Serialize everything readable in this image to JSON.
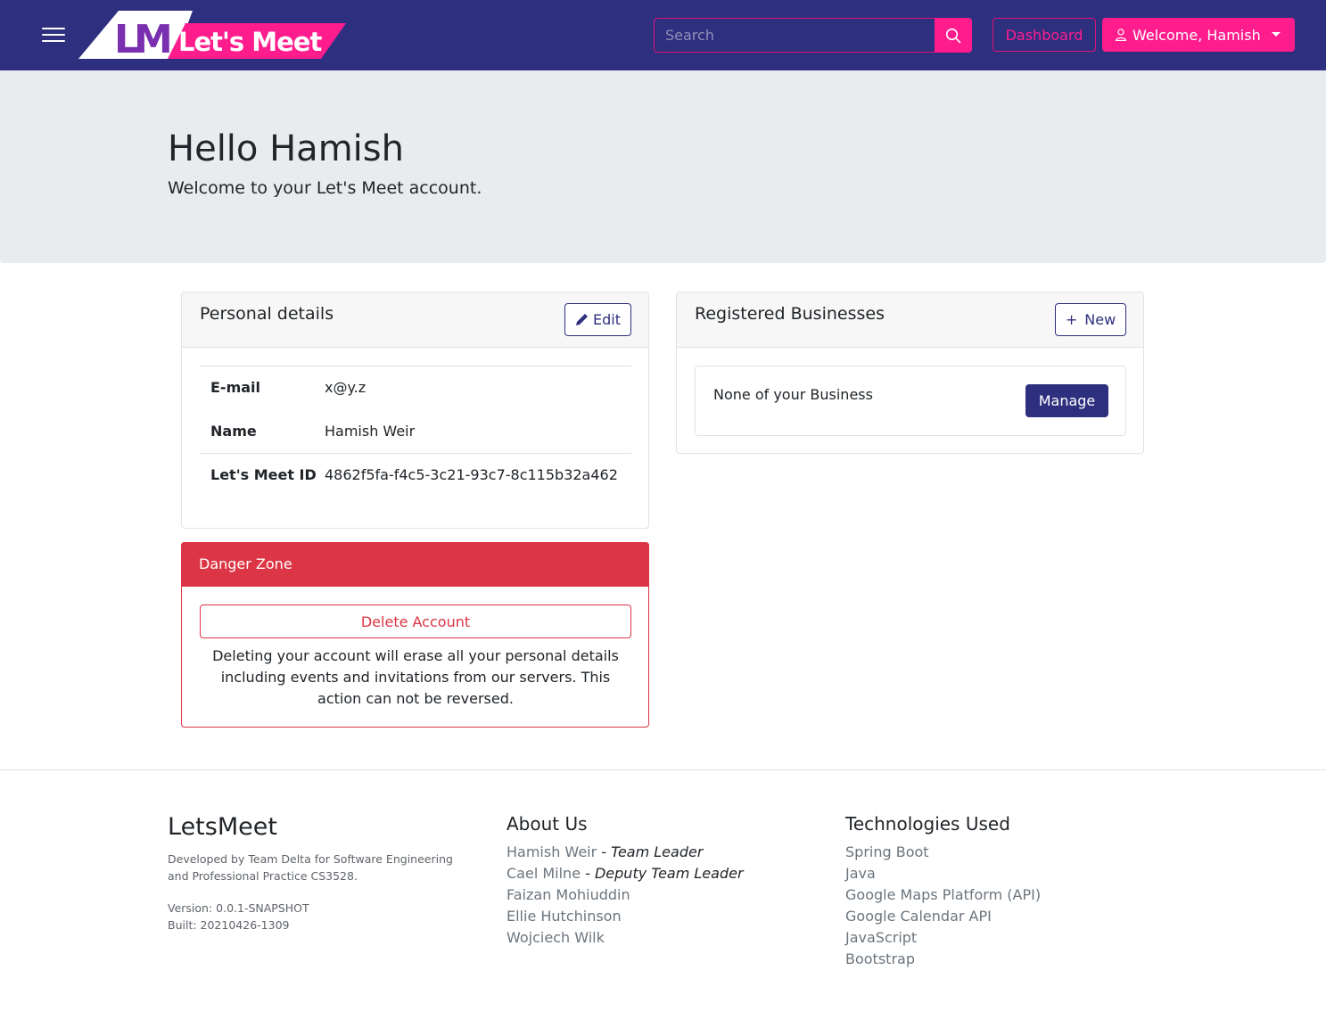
{
  "navbar": {
    "logo_text": "Let's Meet",
    "logo_monogram": "LM",
    "search_placeholder": "Search",
    "dashboard_label": "Dashboard",
    "welcome_label": "Welcome, Hamish",
    "icons": [
      "hamburger-menu-icon",
      "search-icon",
      "user-icon",
      "caret-down-icon"
    ],
    "colors": {
      "nav_bg": "#2e2f7f",
      "accent": "#ff1c8d"
    }
  },
  "hero": {
    "title": "Hello Hamish",
    "subtitle": "Welcome to your Let's Meet account."
  },
  "personal": {
    "title": "Personal details",
    "edit_label": "Edit",
    "rows": [
      {
        "key": "E-mail",
        "value": "x@y.z"
      },
      {
        "key": "Name",
        "value": "Hamish Weir"
      },
      {
        "key": "Let's Meet ID",
        "value": "4862f5fa-f4c5-3c21-93c7-8c115b32a462"
      }
    ]
  },
  "danger": {
    "title": "Danger Zone",
    "delete_label": "Delete Account",
    "warning": "Deleting your account will erase all your personal details including events and invitations from our servers. This action can not be reversed.",
    "color": "#dc3545"
  },
  "businesses": {
    "title": "Registered Businesses",
    "new_label": "New",
    "items": [
      {
        "name": "None of your Business",
        "manage_label": "Manage"
      }
    ]
  },
  "footer": {
    "brand": "LetsMeet",
    "developed_by": "Developed by Team Delta for Software Engineering and Professional Practice CS3528.",
    "version": "Version: 0.0.1-SNAPSHOT",
    "built": "Built: 20210426-1309",
    "about_title": "About Us",
    "team": [
      {
        "name": "Hamish Weir",
        "role": "- Team Leader"
      },
      {
        "name": "Cael Milne",
        "role": "- Deputy Team Leader"
      },
      {
        "name": "Faizan Mohiuddin",
        "role": ""
      },
      {
        "name": "Ellie Hutchinson",
        "role": ""
      },
      {
        "name": "Wojciech Wilk",
        "role": ""
      }
    ],
    "tech_title": "Technologies Used",
    "technologies": [
      "Spring Boot",
      "Java",
      "Google Maps Platform (API)",
      "Google Calendar API",
      "JavaScript",
      "Bootstrap"
    ]
  }
}
